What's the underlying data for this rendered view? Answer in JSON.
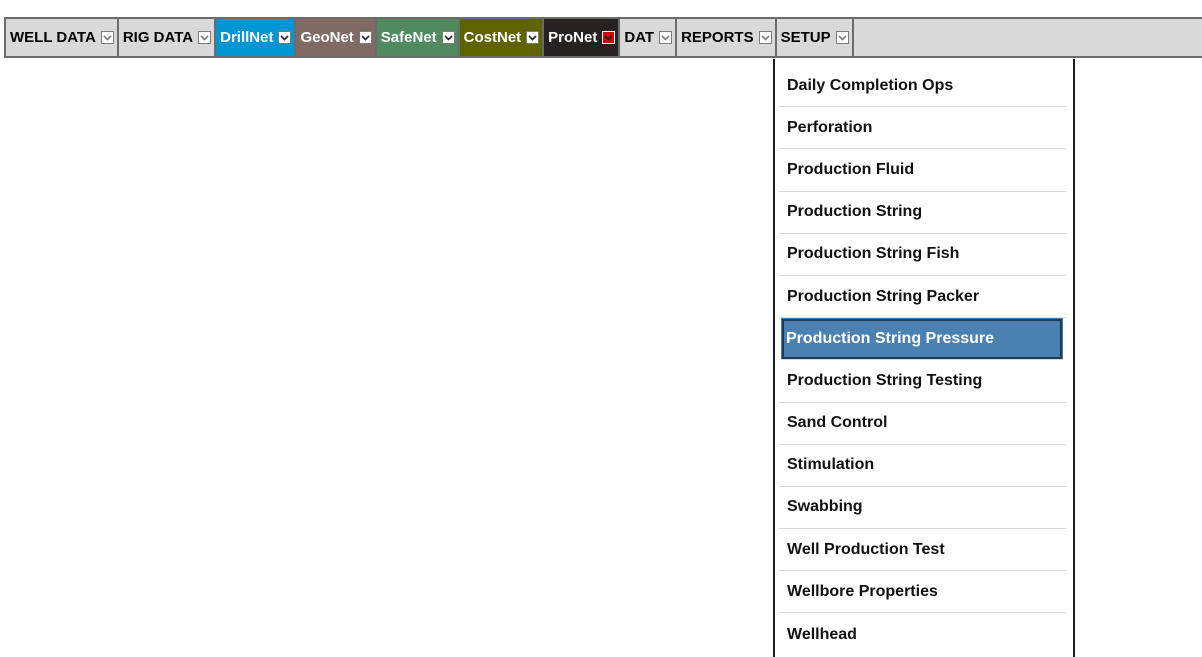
{
  "menubar": {
    "items": [
      {
        "label": "WELL DATA",
        "bg": "#d9d9d9",
        "fg": "#000000",
        "arrow_style": "light",
        "name": "menu-well-data"
      },
      {
        "label": "RIG DATA",
        "bg": "#d9d9d9",
        "fg": "#000000",
        "arrow_style": "light",
        "name": "menu-rig-data"
      },
      {
        "label": "DrillNet",
        "bg": "#0096d6",
        "fg": "#ffffff",
        "arrow_style": "dark",
        "name": "menu-drillnet"
      },
      {
        "label": "GeoNet",
        "bg": "#806a63",
        "fg": "#ffffff",
        "arrow_style": "dark",
        "name": "menu-geonet"
      },
      {
        "label": "SafeNet",
        "bg": "#4f8b5e",
        "fg": "#ffffff",
        "arrow_style": "dark",
        "name": "menu-safenet"
      },
      {
        "label": "CostNet",
        "bg": "#606400",
        "fg": "#ffffff",
        "arrow_style": "dark",
        "name": "menu-costnet"
      },
      {
        "label": "ProNet",
        "bg": "#272222",
        "fg": "#ffffff",
        "arrow_style": "red",
        "name": "menu-pronet"
      },
      {
        "label": "DAT",
        "bg": "#d9d9d9",
        "fg": "#000000",
        "arrow_style": "light",
        "name": "menu-dat"
      },
      {
        "label": "REPORTS",
        "bg": "#d9d9d9",
        "fg": "#000000",
        "arrow_style": "light",
        "name": "menu-reports"
      },
      {
        "label": "SETUP",
        "bg": "#d9d9d9",
        "fg": "#000000",
        "arrow_style": "light",
        "name": "menu-setup"
      }
    ]
  },
  "dropdown": {
    "parent": "ProNet",
    "selected_index": 6,
    "items": [
      "Daily Completion Ops",
      "Perforation",
      "Production Fluid",
      "Production String",
      "Production String Fish",
      "Production String Packer",
      "Production String Pressure",
      "Production String Testing",
      "Sand Control",
      "Stimulation",
      "Swabbing",
      "Well Production Test",
      "Wellbore Properties",
      "Wellhead"
    ]
  },
  "colors": {
    "selected_bg": "#4a81b0",
    "selected_border": "#1c3b59",
    "active_arrow": "#d40000"
  },
  "icons": {
    "dropdown_arrow": "chevron-down-icon"
  }
}
